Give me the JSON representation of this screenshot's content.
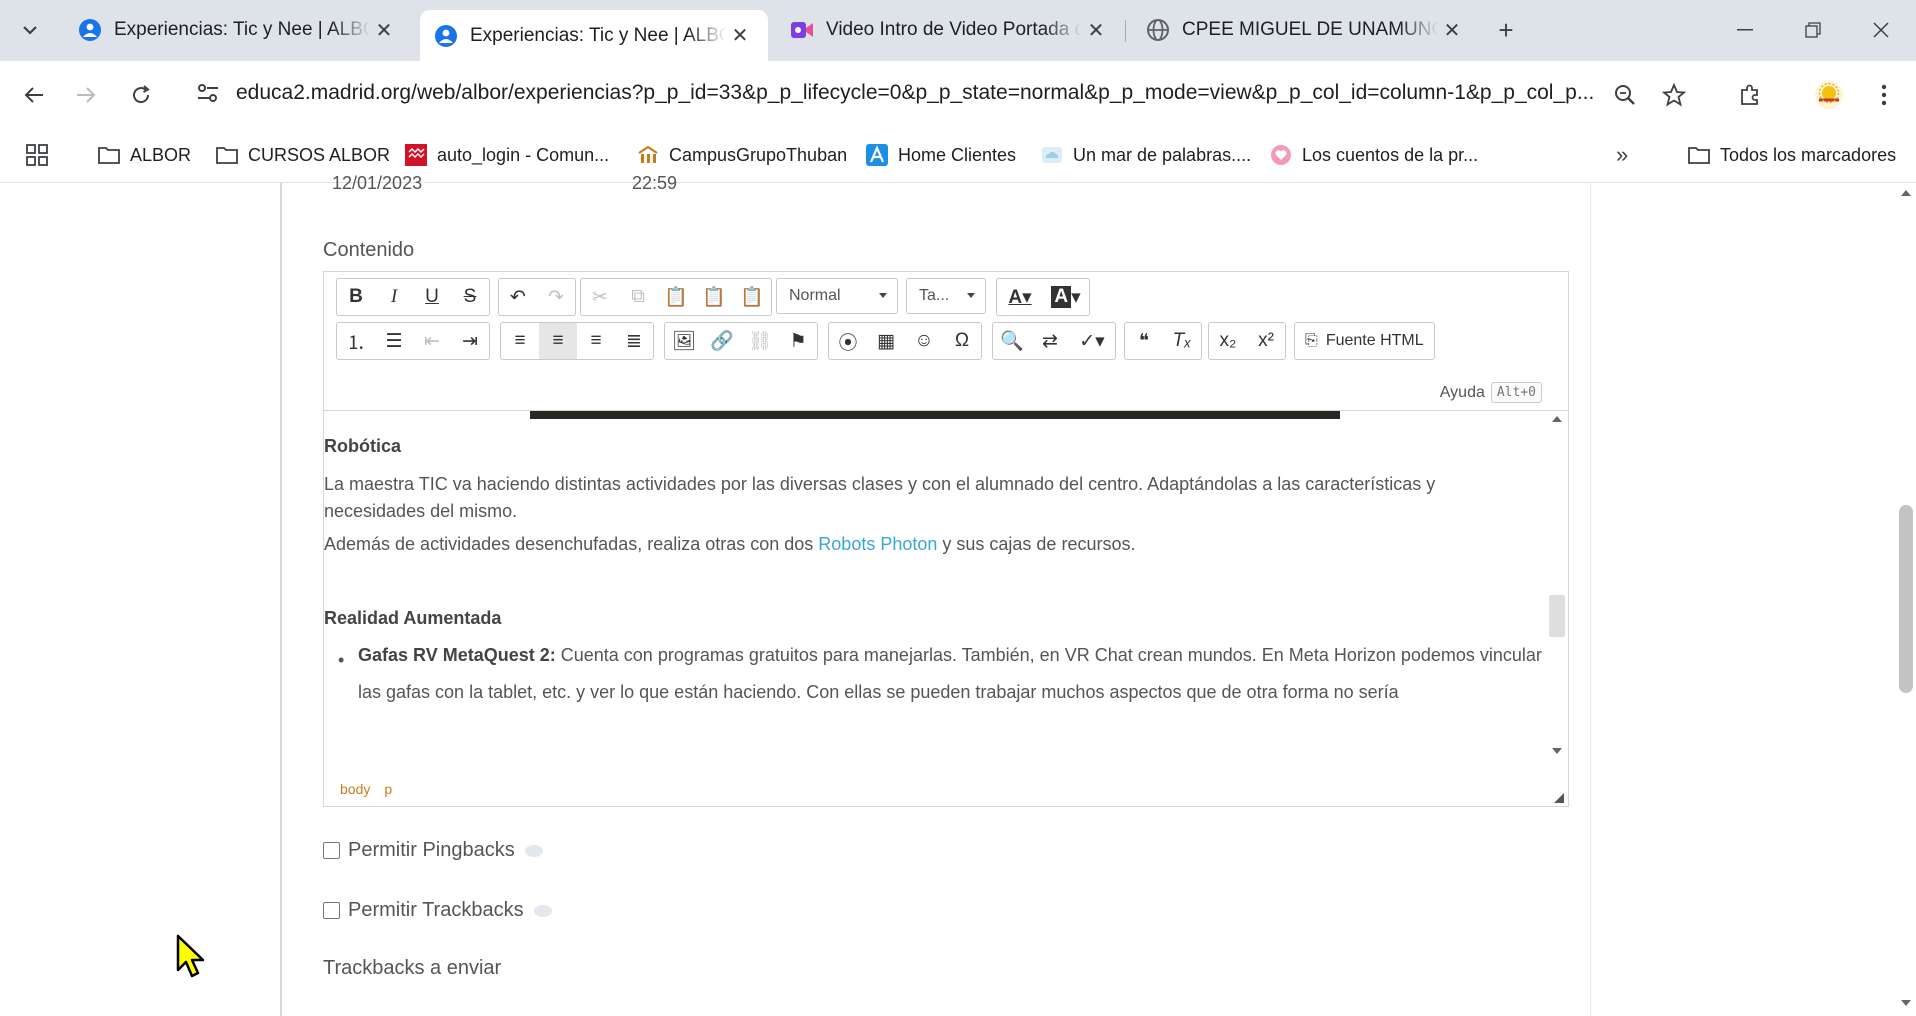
{
  "tabs": [
    {
      "title": "Experiencias: Tic y Nee | ALBOR",
      "favicon": "globe-person-icon"
    },
    {
      "title": "Experiencias: Tic y Nee | ALBOR",
      "favicon": "globe-person-icon"
    },
    {
      "title": "Video Intro de Video Portada d",
      "favicon": "video-icon"
    },
    {
      "title": "CPEE MIGUEL DE UNAMUNO –",
      "favicon": "globe-icon"
    }
  ],
  "address_bar": {
    "url": "educa2.madrid.org/web/albor/experiencias?p_p_id=33&p_p_lifecycle=0&p_p_state=normal&p_p_mode=view&p_p_col_id=column-1&p_p_col_p..."
  },
  "bookmarks": [
    {
      "label": "ALBOR",
      "icon": "folder-icon"
    },
    {
      "label": "CURSOS ALBOR",
      "icon": "folder-icon"
    },
    {
      "label": "auto_login - Comun...",
      "icon": "madrid-logo-icon"
    },
    {
      "label": "CampusGrupoThuban",
      "icon": "campus-icon"
    },
    {
      "label": "Home Clientes",
      "icon": "a-logo-icon"
    },
    {
      "label": "Un mar de palabras....",
      "icon": "cloud-icon"
    },
    {
      "label": "Los cuentos de la pr...",
      "icon": "heart-circle-icon"
    }
  ],
  "bookmarks_more": "»",
  "all_bookmarks": "Todos los marcadores",
  "page": {
    "cut_off_date": "12/01/2023",
    "cut_off_time": "22:59",
    "section_label": "Contenido",
    "editor": {
      "format_combo": "Normal",
      "size_combo": "Ta...",
      "html_source_button": "Fuente HTML",
      "help_label": "Ayuda",
      "help_shortcut": "Alt+0",
      "content": {
        "heading1": "Robótica",
        "para1": "La maestra TIC va haciendo distintas actividades por las diversas clases y con el alumnado del centro. Adaptándolas a las características y necesidades del mismo.",
        "para2_before": "Además de actividades desenchufadas, realiza otras con dos ",
        "para2_link": "Robots Photon",
        "para2_after": " y sus cajas de recursos.",
        "heading2": "Realidad Aumentada",
        "list_item_bold": "Gafas RV MetaQuest 2:",
        "list_item_text": " Cuenta con programas gratuitos para manejarlas. También, en VR Chat crean mundos. En Meta Horizon podemos vincular las gafas con la tablet, etc. y ver lo que están haciendo. Con ellas se pueden trabajar muchos aspectos que de otra forma no sería"
      },
      "path": [
        "body",
        "p"
      ]
    },
    "pingbacks_label": "Permitir Pingbacks",
    "trackbacks_label": "Permitir Trackbacks",
    "trackbacks_send_label": "Trackbacks a enviar"
  }
}
